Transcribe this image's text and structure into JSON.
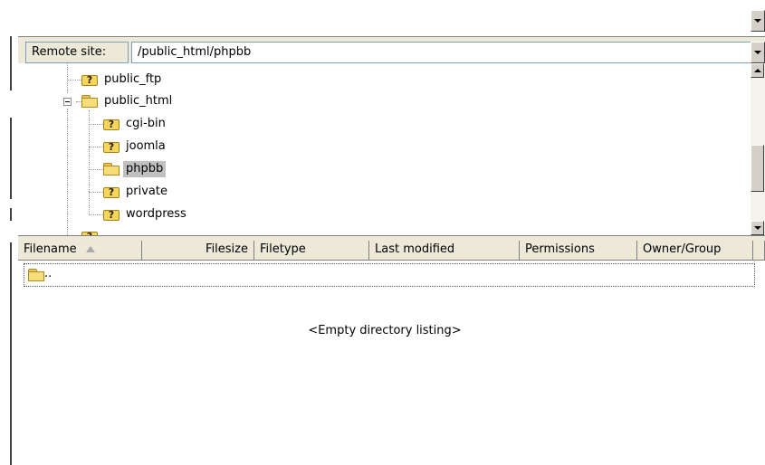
{
  "remote_site": {
    "label": "Remote site:",
    "path": "/public_html/phpbb"
  },
  "tree": {
    "items": [
      {
        "label": "public_ftp",
        "icon": "unknown-folder-icon"
      },
      {
        "label": "public_html",
        "icon": "folder-icon",
        "expanded": true
      },
      {
        "label": "cgi-bin",
        "icon": "unknown-folder-icon"
      },
      {
        "label": "joomla",
        "icon": "unknown-folder-icon"
      },
      {
        "label": "phpbb",
        "icon": "folder-icon",
        "selected": true
      },
      {
        "label": "private",
        "icon": "unknown-folder-icon"
      },
      {
        "label": "wordpress",
        "icon": "unknown-folder-icon"
      }
    ]
  },
  "file_list": {
    "columns": [
      "Filename",
      "Filesize",
      "Filetype",
      "Last modified",
      "Permissions",
      "Owner/Group"
    ],
    "parent_entry": "..",
    "empty_message": "<Empty directory listing>"
  },
  "colors": {
    "panel_bg": "#ece9d8",
    "selection": "#c0c0c0",
    "folder": "#f7dc7a"
  }
}
